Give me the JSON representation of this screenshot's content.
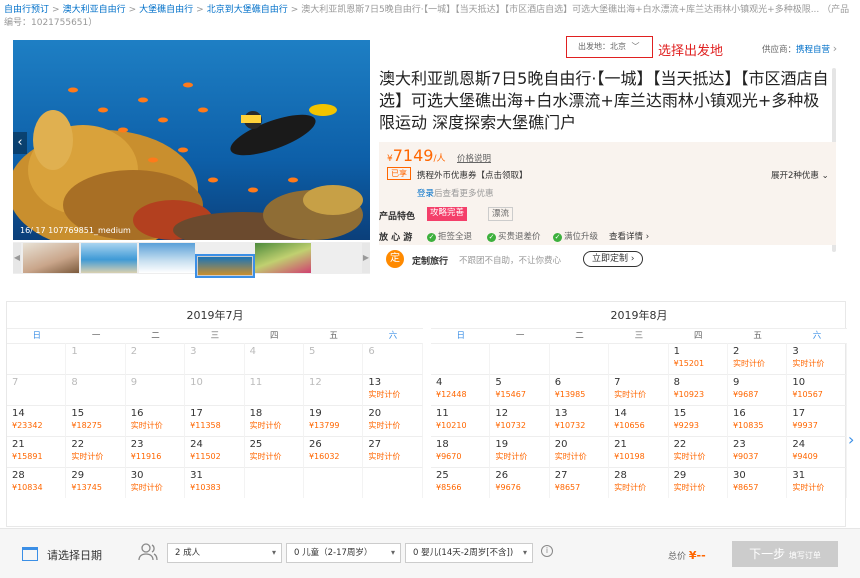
{
  "breadcrumb": {
    "items": [
      "自由行预订",
      "澳大利亚自由行",
      "大堡礁自由行",
      "北京到大堡礁自由行"
    ],
    "tail": "澳大利亚凯恩斯7日5晚自由行·【一城】【当天抵达】【市区酒店自选】可选大堡礁出海+白水漂流+库兰达雨林小镇观光+多种极限... （产品编号：1021755651）"
  },
  "gallery": {
    "caption": "16/ 17 107769851_medium",
    "prev": "‹",
    "thumb_prev": "◀",
    "thumb_next": "▶"
  },
  "departure": {
    "label": "出发地：北京",
    "caret": "﹀",
    "annotation": "选择出发地"
  },
  "supplier": {
    "label": "供应商：",
    "name": "携程自营",
    "arrow": "›"
  },
  "product": {
    "title": "澳大利亚凯恩斯7日5晚自由行·【一城】【当天抵达】【市区酒店自选】可选大堡礁出海+白水漂流+库兰达雨林小镇观光+多种极限运动 深度探索大堡礁门户"
  },
  "pricing": {
    "currency": "¥",
    "price": "7149",
    "per": "/人",
    "price_desc": "价格说明",
    "coupon_tag": "已享",
    "coupon_text": "携程外币优惠券【点击领取】",
    "more_offers": "展开2种优惠 ⌄",
    "login_link": "登录",
    "login_tail": "后查看更多优惠"
  },
  "features": {
    "label": "产品特色",
    "tag1": "攻略完善",
    "tag2": "漂流",
    "reassure_label": "放 心 游",
    "reassure_items": [
      "拒签全退",
      "买贵退差价",
      "满位升级"
    ],
    "details": "查看详情 ›"
  },
  "custom": {
    "title": "定制旅行",
    "desc": "不跟团不自助，不让你费心",
    "button": "立即定制 ›"
  },
  "calendar": {
    "weekdays": [
      "日",
      "一",
      "二",
      "三",
      "四",
      "五",
      "六"
    ],
    "months": [
      {
        "title": "2019年7月",
        "days": [
          {
            "n": "",
            "p": ""
          },
          {
            "n": "1",
            "p": "",
            "m": true
          },
          {
            "n": "2",
            "p": "",
            "m": true
          },
          {
            "n": "3",
            "p": "",
            "m": true
          },
          {
            "n": "4",
            "p": "",
            "m": true
          },
          {
            "n": "5",
            "p": "",
            "m": true
          },
          {
            "n": "6",
            "p": "",
            "m": true
          },
          {
            "n": "7",
            "p": "",
            "m": true
          },
          {
            "n": "8",
            "p": "",
            "m": true
          },
          {
            "n": "9",
            "p": "",
            "m": true
          },
          {
            "n": "10",
            "p": "",
            "m": true
          },
          {
            "n": "11",
            "p": "",
            "m": true
          },
          {
            "n": "12",
            "p": "",
            "m": true
          },
          {
            "n": "13",
            "p": "实时计价"
          },
          {
            "n": "14",
            "p": "¥23342"
          },
          {
            "n": "15",
            "p": "¥18275"
          },
          {
            "n": "16",
            "p": "实时计价"
          },
          {
            "n": "17",
            "p": "¥11358"
          },
          {
            "n": "18",
            "p": "实时计价"
          },
          {
            "n": "19",
            "p": "¥13799"
          },
          {
            "n": "20",
            "p": "实时计价"
          },
          {
            "n": "21",
            "p": "¥15891"
          },
          {
            "n": "22",
            "p": "实时计价"
          },
          {
            "n": "23",
            "p": "¥11916"
          },
          {
            "n": "24",
            "p": "¥11502"
          },
          {
            "n": "25",
            "p": "实时计价"
          },
          {
            "n": "26",
            "p": "¥16032"
          },
          {
            "n": "27",
            "p": "实时计价"
          },
          {
            "n": "28",
            "p": "¥10834"
          },
          {
            "n": "29",
            "p": "¥13745"
          },
          {
            "n": "30",
            "p": "实时计价"
          },
          {
            "n": "31",
            "p": "¥10383"
          },
          {
            "n": "",
            "p": ""
          },
          {
            "n": "",
            "p": ""
          },
          {
            "n": "",
            "p": ""
          }
        ]
      },
      {
        "title": "2019年8月",
        "days": [
          {
            "n": "",
            "p": ""
          },
          {
            "n": "",
            "p": ""
          },
          {
            "n": "",
            "p": ""
          },
          {
            "n": "",
            "p": ""
          },
          {
            "n": "1",
            "p": "¥15201"
          },
          {
            "n": "2",
            "p": "实时计价"
          },
          {
            "n": "3",
            "p": "实时计价"
          },
          {
            "n": "4",
            "p": "¥12448"
          },
          {
            "n": "5",
            "p": "¥15467"
          },
          {
            "n": "6",
            "p": "¥13985"
          },
          {
            "n": "7",
            "p": "实时计价"
          },
          {
            "n": "8",
            "p": "¥10923"
          },
          {
            "n": "9",
            "p": "¥9687"
          },
          {
            "n": "10",
            "p": "¥10567"
          },
          {
            "n": "11",
            "p": "¥10210"
          },
          {
            "n": "12",
            "p": "¥10732"
          },
          {
            "n": "13",
            "p": "¥10732"
          },
          {
            "n": "14",
            "p": "¥10656"
          },
          {
            "n": "15",
            "p": "¥9293"
          },
          {
            "n": "16",
            "p": "¥10835"
          },
          {
            "n": "17",
            "p": "¥9937"
          },
          {
            "n": "18",
            "p": "¥9670"
          },
          {
            "n": "19",
            "p": "实时计价"
          },
          {
            "n": "20",
            "p": "实时计价"
          },
          {
            "n": "21",
            "p": "¥10198"
          },
          {
            "n": "22",
            "p": "实时计价"
          },
          {
            "n": "23",
            "p": "¥9037"
          },
          {
            "n": "24",
            "p": "¥9409"
          },
          {
            "n": "25",
            "p": "¥8566"
          },
          {
            "n": "26",
            "p": "¥9676"
          },
          {
            "n": "27",
            "p": "¥8657"
          },
          {
            "n": "28",
            "p": "实时计价"
          },
          {
            "n": "29",
            "p": "实时计价"
          },
          {
            "n": "30",
            "p": "¥8657"
          },
          {
            "n": "31",
            "p": "实时计价"
          }
        ]
      }
    ]
  },
  "booking": {
    "pick_date": "请选择日期",
    "adults": "2  成人",
    "children": "0  儿童（2-17周岁）",
    "infants": "0  婴儿(14天-2周岁[不含])",
    "info": "i",
    "caret": "▾",
    "total_label": "总价",
    "total_value": "¥--",
    "next_label": "下一步",
    "next_sub": "填写订单"
  },
  "colors": {
    "link": "#0070c9",
    "price": "#ff6600",
    "weekend": "#3b8fe6",
    "annotation": "#e02020"
  }
}
